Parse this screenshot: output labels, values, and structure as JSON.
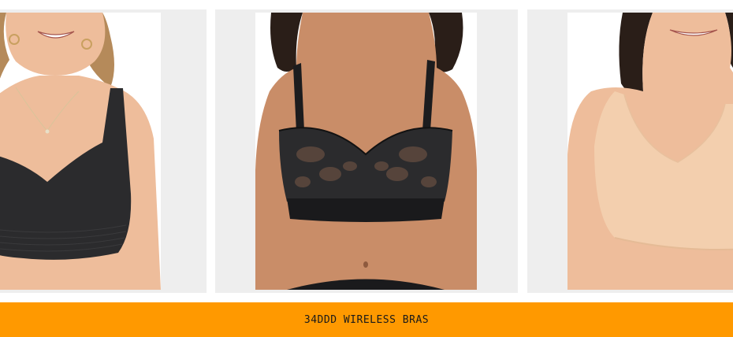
{
  "colors": {
    "banner_bg": "#ff9900",
    "card_bg": "#eeeeee",
    "skin_light": "#eebd9b",
    "skin_tan": "#c98d68",
    "bra_black": "#2b2b2d",
    "bra_nude": "#f3cfae",
    "hair_blonde": "#b58a5a",
    "hair_dark": "#2a1e18"
  },
  "products": [
    {
      "image_name": "black-seamless-wireless-bra-photo"
    },
    {
      "image_name": "black-lace-wireless-bra-photo"
    },
    {
      "image_name": "nude-seamless-wireless-bra-photo"
    }
  ],
  "banner": {
    "label": "34DDD WIRELESS BRAS"
  }
}
